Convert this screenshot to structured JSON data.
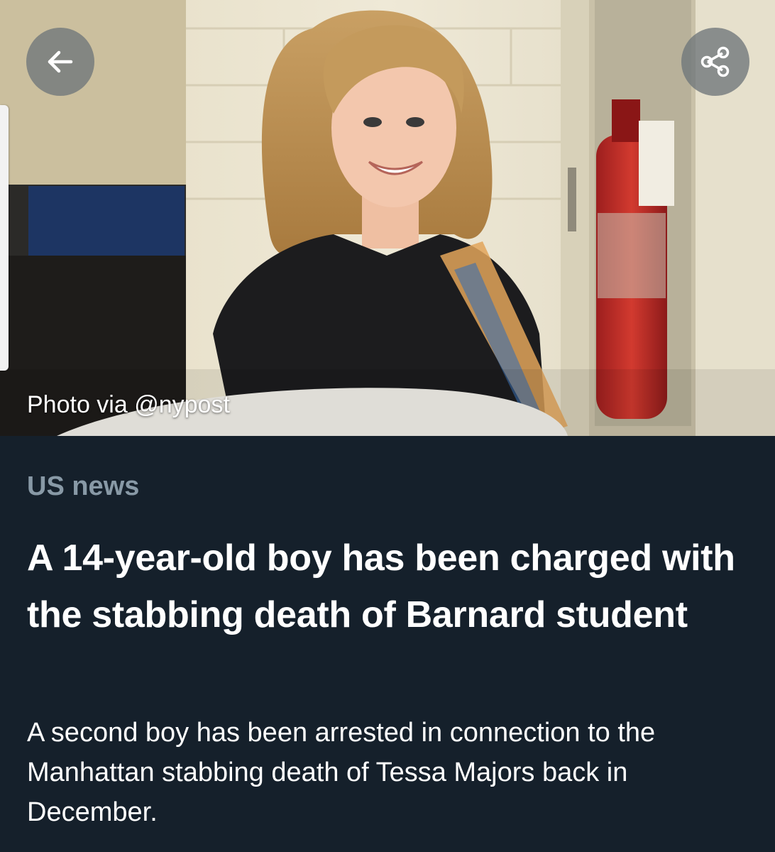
{
  "hero": {
    "photo_credit": "Photo via @nypost",
    "back_icon": "arrow-left-icon",
    "share_icon": "share-icon"
  },
  "article": {
    "category": "US news",
    "headline": "A 14-year-old boy has been charged with the stabbing death of Barnard student",
    "summary": "A second boy has been arrested in connection to the Manhattan stabbing death of Tessa Majors back in December."
  },
  "colors": {
    "background": "#15202b",
    "category_text": "#8899a6",
    "headline_text": "#ffffff",
    "button_overlay": "#6e767a"
  }
}
